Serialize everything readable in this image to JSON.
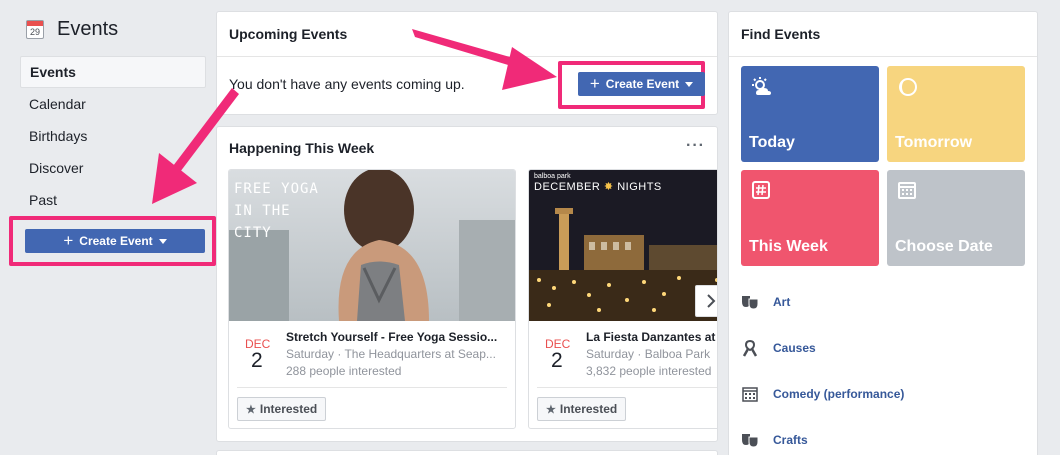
{
  "sidebar": {
    "calendar_icon_day": "29",
    "title": "Events",
    "items": [
      {
        "label": "Events",
        "active": true
      },
      {
        "label": "Calendar"
      },
      {
        "label": "Birthdays"
      },
      {
        "label": "Discover"
      },
      {
        "label": "Past"
      }
    ],
    "create_button": "Create Event"
  },
  "upcoming": {
    "title": "Upcoming Events",
    "empty_text": "You don't have any events coming up.",
    "create_button": "Create Event"
  },
  "happening": {
    "title": "Happening This Week",
    "more_icon": "ellipsis-icon",
    "events": [
      {
        "photo_text": [
          "FREE YOGA",
          "IN THE",
          "CITY"
        ],
        "month": "DEC",
        "day": "2",
        "name": "Stretch Yourself - Free Yoga Sessio...",
        "location": "Saturday · The Headquarters at Seap...",
        "interested": "288 people interested",
        "button": "Interested"
      },
      {
        "photo_text": [
          "balboa park",
          "DECEMBER",
          "NIGHTS"
        ],
        "month": "DEC",
        "day": "2",
        "name": "La Fiesta Danzantes at",
        "location": "Saturday · Balboa Park",
        "interested": "3,832 people interested",
        "button": "Interested"
      }
    ]
  },
  "find_events": {
    "title": "Find Events",
    "tiles": [
      {
        "label": "Today",
        "color": "#4267b2",
        "icon": "sun-cloud-icon"
      },
      {
        "label": "Tomorrow",
        "color": "#f7d57f",
        "icon": "moon-icon"
      },
      {
        "label": "This Week",
        "color": "#f0556e",
        "icon": "hash-icon"
      },
      {
        "label": "Choose Date",
        "color": "#bec3c9",
        "icon": "calendar-icon"
      }
    ],
    "categories": [
      {
        "label": "Art",
        "icon": "masks-icon"
      },
      {
        "label": "Causes",
        "icon": "ribbon-icon"
      },
      {
        "label": "Comedy (performance)",
        "icon": "calendar-grid-icon"
      },
      {
        "label": "Crafts",
        "icon": "masks-icon"
      }
    ]
  },
  "colors": {
    "accent": "#4267b2",
    "highlight": "#f02a78",
    "date_red": "#e9504f"
  }
}
